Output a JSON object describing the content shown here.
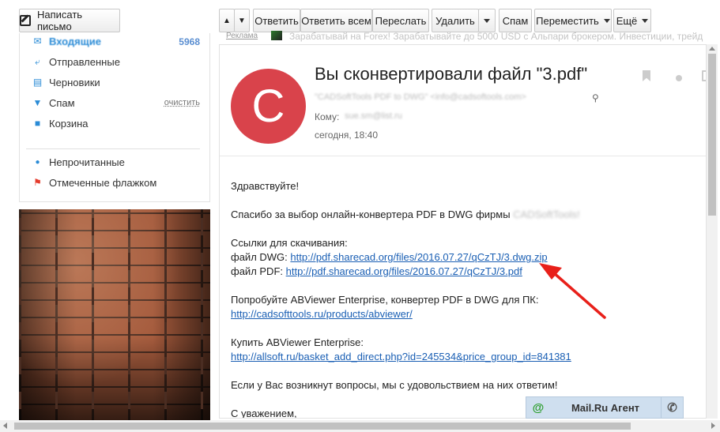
{
  "compose": {
    "label": "Написать письмо"
  },
  "toolbar": {
    "reply": "Ответить",
    "reply_all": "Ответить всем",
    "forward": "Переслать",
    "delete": "Удалить",
    "spam": "Спам",
    "move": "Переместить",
    "more": "Ещё"
  },
  "sidebar": {
    "inbox": {
      "label": "Входящие",
      "count": "5968"
    },
    "sent": {
      "label": "Отправленные"
    },
    "drafts": {
      "label": "Черновики"
    },
    "spam": {
      "label": "Спам",
      "action": "очистить"
    },
    "trash": {
      "label": "Корзина"
    },
    "unread": {
      "label": "Непрочитанные"
    },
    "flagged": {
      "label": "Отмеченные флажком"
    }
  },
  "ad": {
    "label": "Реклама",
    "text": "Зарабатывай на Forex! Зарабатывайте до 5000 USD с Альпари брокером. Инвестиции, трейд"
  },
  "message": {
    "avatar_letter": "C",
    "subject": "Вы сконвертировали файл \"3.pdf\"",
    "from": "\"CADSoftTools PDF to DWG\" <info@cadsoftools.com>",
    "to_label": "Кому:",
    "to_value": "sue.sm@list.ru",
    "date": "сегодня, 18:40",
    "greeting": "Здравствуйте!",
    "thanks": "Спасибо за выбор онлайн-конвертера PDF в DWG фирмы",
    "company": "CADSoftTools!",
    "links_header": "Ссылки для скачивания:",
    "dwg_label": "файл DWG:",
    "dwg_link": "http://pdf.sharecad.org/files/2016.07.27/qCzTJ/3.dwg.zip",
    "pdf_label": "файл PDF:",
    "pdf_link": "http://pdf.sharecad.org/files/2016.07.27/qCzTJ/3.pdf",
    "try_text": "Попробуйте ABViewer Enterprise, конвертер PDF в DWG для ПК:",
    "try_link": "http://cadsofttools.ru/products/abviewer/",
    "buy_text": "Купить ABViewer Enterprise:",
    "buy_link": "http://allsoft.ru/basket_add_direct.php?id=245534&price_group_id=841381",
    "questions": "Если у Вас возникнут вопросы, мы с удовольствием на них ответим!",
    "regards": "С уважением,"
  },
  "agent": {
    "label": "Mail.Ru Агент"
  },
  "colors": {
    "avatar": "#d9434b",
    "link": "#1a5fb4",
    "arrow": "#e8201a",
    "agent_bg": "#cfdfef"
  }
}
